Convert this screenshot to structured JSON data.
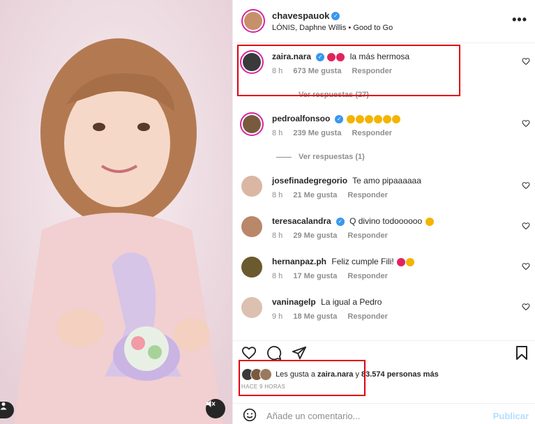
{
  "post": {
    "author": "chavespauok",
    "audio": "LÓNIS, Daphne Willis • Good to Go",
    "more": "•••"
  },
  "comments": [
    {
      "user": "zaira.nara",
      "verified": true,
      "text": "la más hermosa",
      "time": "8 h",
      "likes": "673 Me gusta",
      "reply": "Responder",
      "view_replies": "Ver respuestas (27)"
    },
    {
      "user": "pedroalfonsoo",
      "verified": true,
      "text": "",
      "time": "8 h",
      "likes": "239 Me gusta",
      "reply": "Responder",
      "view_replies": "Ver respuestas (1)"
    },
    {
      "user": "josefinadegregorio",
      "verified": false,
      "text": "Te amo pipaaaaaa",
      "time": "8 h",
      "likes": "21 Me gusta",
      "reply": "Responder"
    },
    {
      "user": "teresacalandra",
      "verified": true,
      "text": "Q divino todoooooo",
      "time": "8 h",
      "likes": "29 Me gusta",
      "reply": "Responder"
    },
    {
      "user": "hernanpaz.ph",
      "verified": false,
      "text": "Feliz cumple Fili!",
      "time": "8 h",
      "likes": "17 Me gusta",
      "reply": "Responder"
    },
    {
      "user": "vaninagelp",
      "verified": false,
      "text": "La igual a Pedro",
      "time": "9 h",
      "likes": "18 Me gusta",
      "reply": "Responder"
    }
  ],
  "likes_line": {
    "prefix": "Les gusta a",
    "user": "zaira.nara",
    "joiner": "y",
    "count": "83.574 personas más"
  },
  "time_ago": "HACE 9 HORAS",
  "add_comment": {
    "placeholder": "Añade un comentario...",
    "publish": "Publicar"
  },
  "colors": {
    "verified": "#3897f0",
    "highlight_box": "#e0000e",
    "publish": "#b2dffc"
  }
}
